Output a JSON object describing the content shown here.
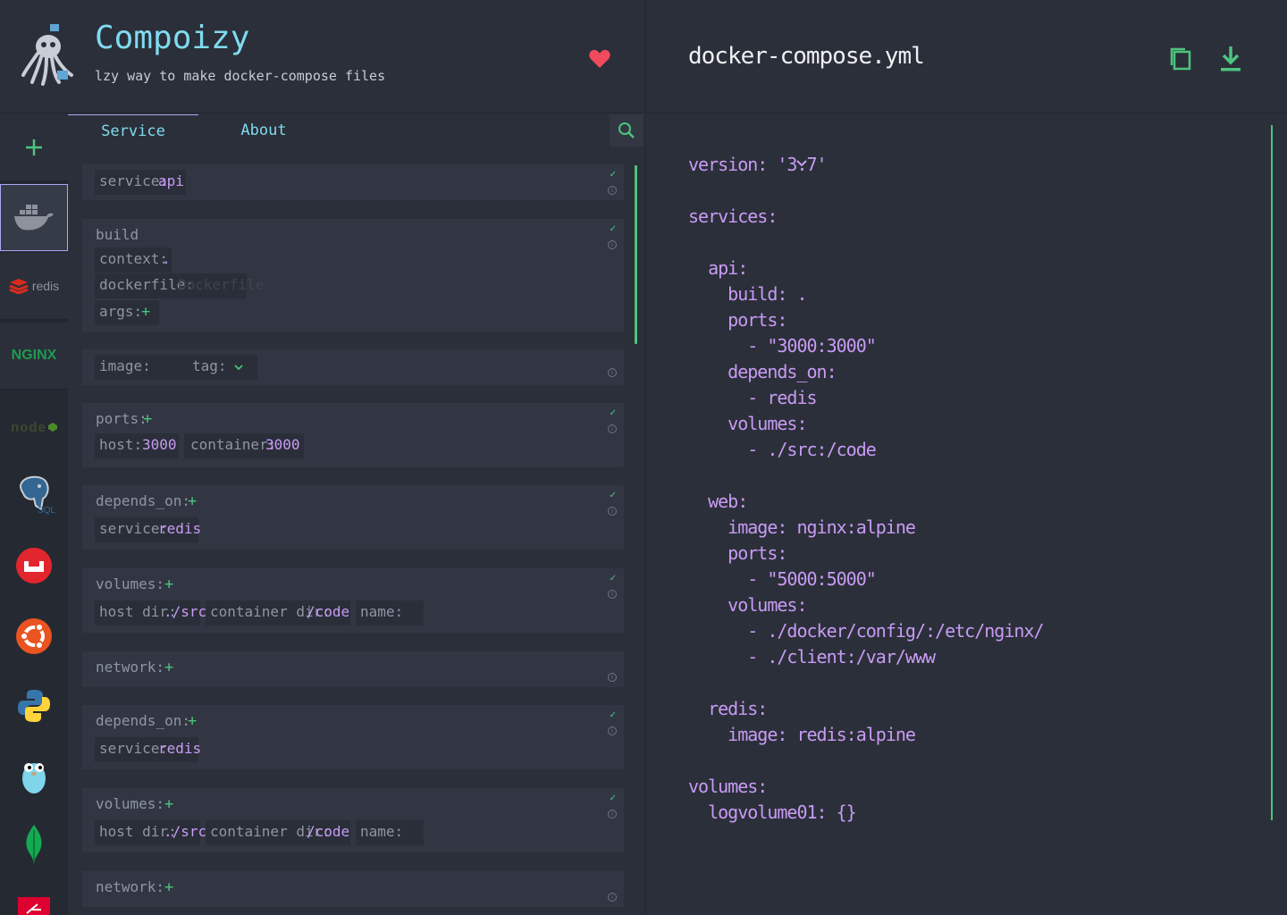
{
  "header": {
    "app_title": "Compoizy",
    "app_subtitle": "lzy way to make docker-compose files",
    "file_title": "docker-compose.yml"
  },
  "colors": {
    "accent_cyan": "#7fdbf0",
    "accent_green": "#4cc47e",
    "value_purple": "#c89bf5",
    "heart_red": "#ef4b5d",
    "bg": "#2b2f39"
  },
  "rail": {
    "add_icon": "plus-icon",
    "items": [
      "docker-icon",
      "redis-icon",
      "nginx-icon",
      "nodejs-icon",
      "postgresql-icon",
      "couchbase-icon",
      "ubuntu-icon",
      "python-icon",
      "golang-gopher-icon",
      "mongodb-icon",
      "angular-icon"
    ],
    "labels": {
      "redis": "redis",
      "nginx": "NGINX",
      "node": "node",
      "sql": "SQL"
    }
  },
  "tabs": {
    "service": "Service",
    "about": "About"
  },
  "form": {
    "service": {
      "label": "service:",
      "value": "api"
    },
    "build": {
      "title": "build",
      "context_label": "context:",
      "context_value": ".",
      "dockerfile_label": "dockerfile:",
      "dockerfile_placeholder": "Dockerfile",
      "args_label": "args:",
      "args_add": "+"
    },
    "image": {
      "label": "image:",
      "tag_label": "tag:"
    },
    "ports": {
      "label": "ports:",
      "add": "+",
      "host_label": "host:",
      "host_value": "3000",
      "container_label": "container:",
      "container_value": "3000"
    },
    "depends_on_1": {
      "label": "depends_on:",
      "add": "+",
      "service_label": "service:",
      "service_value": "redis"
    },
    "volumes_1": {
      "label": "volumes:",
      "add": "+",
      "host_dir_label": "host dir:",
      "host_dir_value": "./src",
      "container_dir_label": "container dir:",
      "container_dir_value": "/code",
      "name_label": "name:"
    },
    "network_1": {
      "label": "network:",
      "add": "+"
    },
    "depends_on_2": {
      "label": "depends_on:",
      "add": "+",
      "service_label": "service:",
      "service_value": "redis"
    },
    "volumes_2": {
      "label": "volumes:",
      "add": "+",
      "host_dir_label": "host dir:",
      "host_dir_value": "./src",
      "container_dir_label": "container dir:",
      "container_dir_value": "/code",
      "name_label": "name:"
    },
    "network_2": {
      "label": "network:",
      "add": "+"
    },
    "check_mark": "✓",
    "info_mark": "i"
  },
  "yaml": {
    "lines": [
      "version: '3.7'",
      "",
      "services:",
      "",
      "  api:",
      "    build: .",
      "    ports:",
      "      - \"3000:3000\"",
      "    depends_on:",
      "      - redis",
      "    volumes:",
      "      - ./src:/code",
      "",
      "  web:",
      "    image: nginx:alpine",
      "    ports:",
      "      - \"5000:5000\"",
      "    volumes:",
      "      - ./docker/config/:/etc/nginx/",
      "      - ./client:/var/www",
      "",
      "  redis:",
      "    image: redis:alpine",
      "",
      "volumes:",
      "  logvolume01: {}"
    ]
  }
}
